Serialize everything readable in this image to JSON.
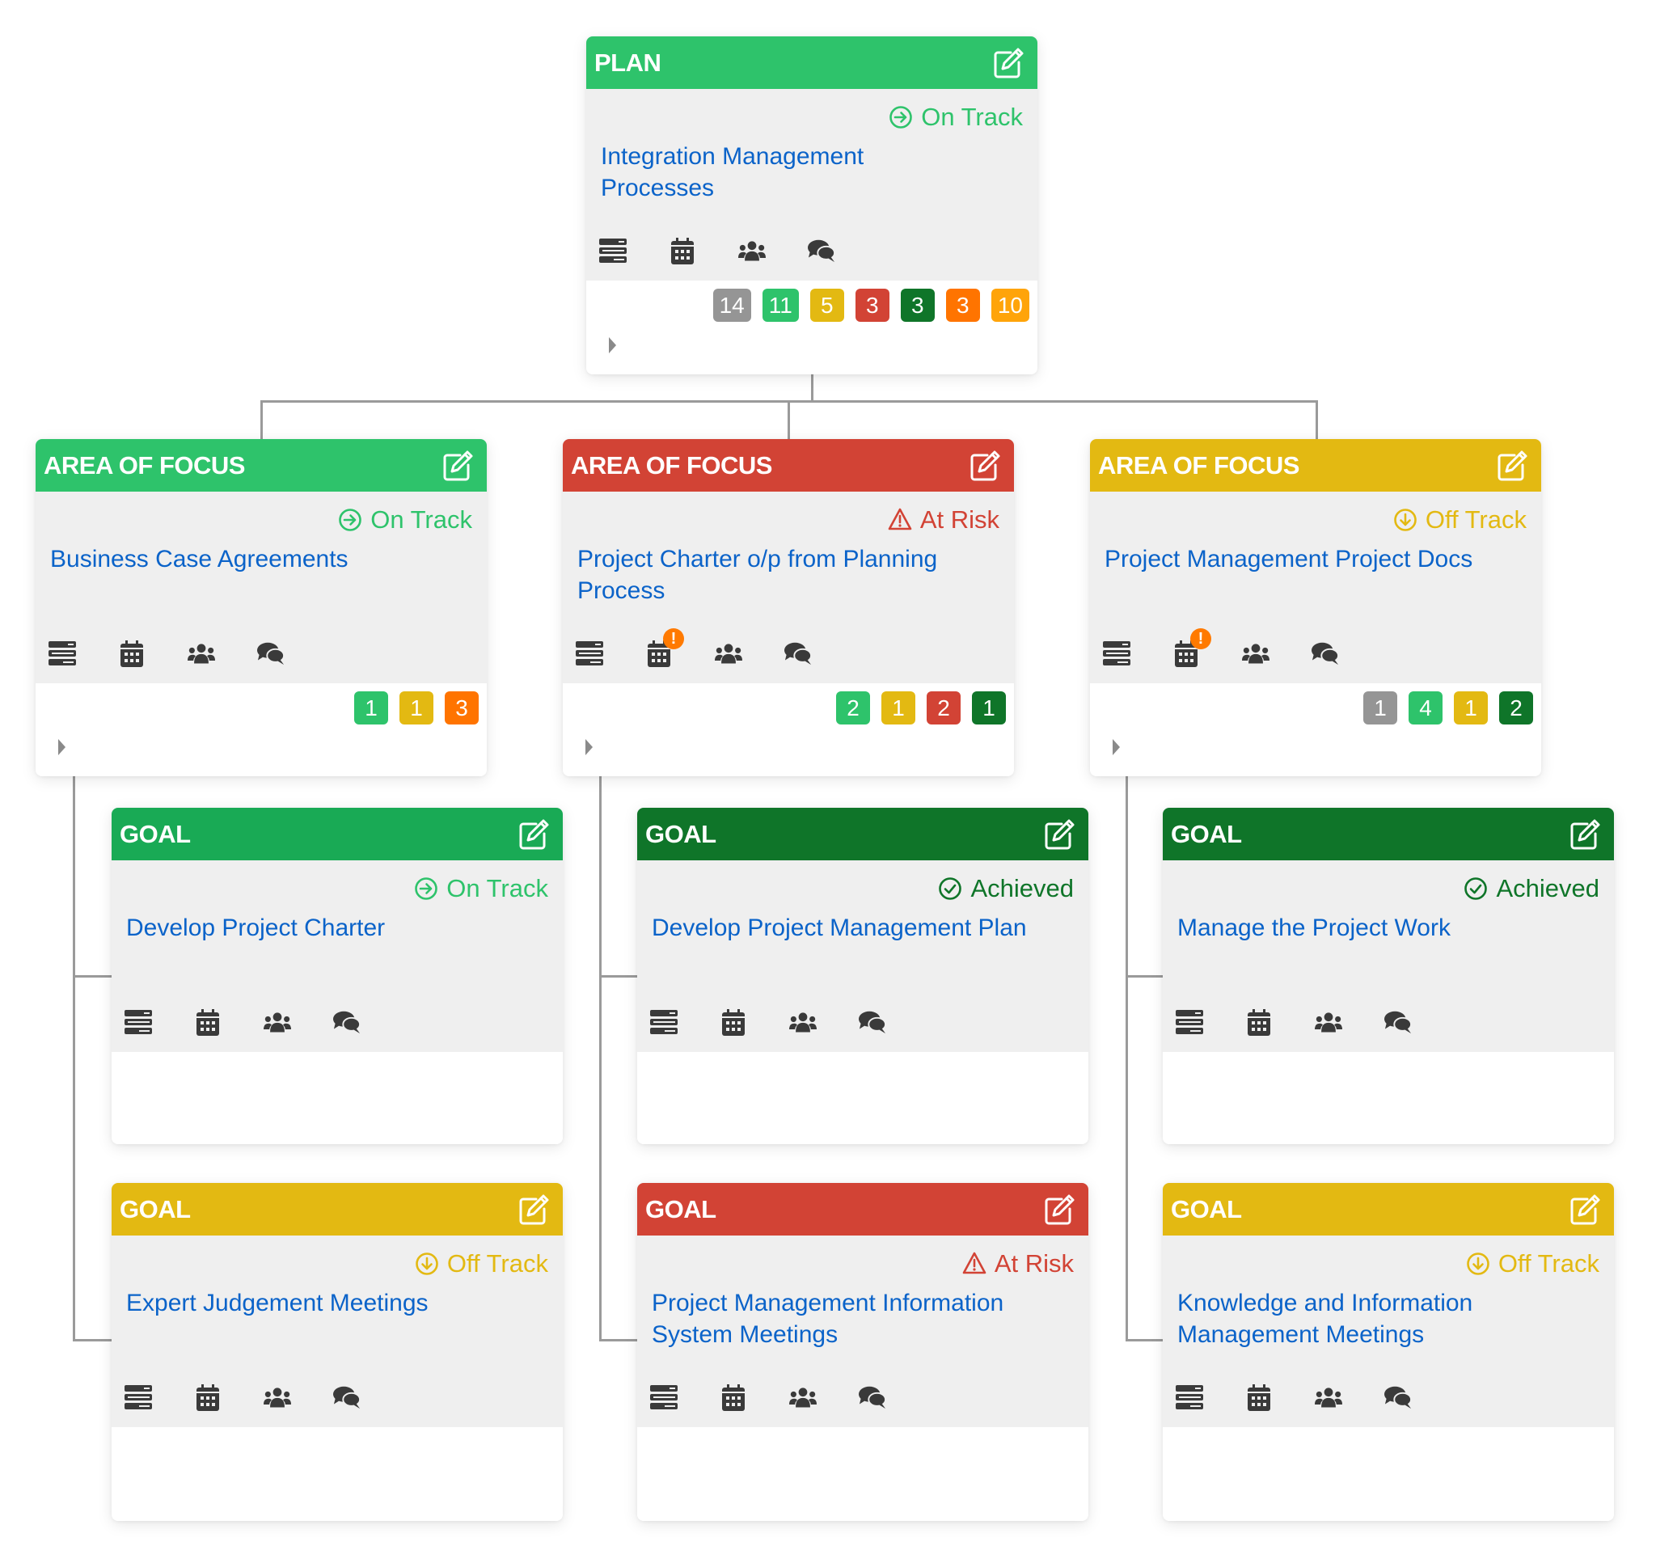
{
  "colors": {
    "on_track": "#2ec36b",
    "goal_on_track_header": "#19aa55",
    "at_risk": "#d24335",
    "off_track": "#e3b912",
    "achieved": "#0f7529",
    "not_started": "#959595",
    "orange": "#ff7400",
    "amber": "#ffa40a",
    "link": "#0b63c9",
    "icon": "#3a3a3a"
  },
  "plan": {
    "type_label": "PLAN",
    "status": {
      "label": "On Track",
      "icon": "arrow-circle-right-icon"
    },
    "name_line1": "Integration Management",
    "name_line2": "Processes",
    "badges": [
      {
        "value": "14",
        "status": "not-started"
      },
      {
        "value": "11",
        "status": "on-track"
      },
      {
        "value": "5",
        "status": "off-track"
      },
      {
        "value": "3",
        "status": "at-risk"
      },
      {
        "value": "3",
        "status": "achieved"
      },
      {
        "value": "3",
        "status": "orange"
      },
      {
        "value": "10",
        "status": "amber"
      }
    ]
  },
  "areas_of_focus": [
    {
      "type_label": "AREA OF FOCUS",
      "status": {
        "label": "On Track",
        "icon": "arrow-circle-right-icon"
      },
      "name_line1": "Business Case Agreements",
      "name_line2": "",
      "calendar_alert": false,
      "badges": [
        {
          "value": "1",
          "status": "on-track"
        },
        {
          "value": "1",
          "status": "off-track"
        },
        {
          "value": "3",
          "status": "orange"
        }
      ]
    },
    {
      "type_label": "AREA OF FOCUS",
      "status": {
        "label": "At Risk",
        "icon": "warning-triangle-icon"
      },
      "name_line1": "Project Charter o/p from Planning",
      "name_line2": "Process",
      "calendar_alert": true,
      "calendar_alert_symbol": "!",
      "badges": [
        {
          "value": "2",
          "status": "on-track"
        },
        {
          "value": "1",
          "status": "off-track"
        },
        {
          "value": "2",
          "status": "at-risk"
        },
        {
          "value": "1",
          "status": "achieved"
        }
      ]
    },
    {
      "type_label": "AREA OF FOCUS",
      "status": {
        "label": "Off Track",
        "icon": "arrow-circle-down-icon"
      },
      "name_line1": "Project Management Project Docs",
      "name_line2": "",
      "calendar_alert": true,
      "calendar_alert_symbol": "!",
      "badges": [
        {
          "value": "1",
          "status": "not-started"
        },
        {
          "value": "4",
          "status": "on-track"
        },
        {
          "value": "1",
          "status": "off-track"
        },
        {
          "value": "2",
          "status": "achieved"
        }
      ]
    }
  ],
  "goals": [
    {
      "type_label": "GOAL",
      "status": {
        "label": "On Track",
        "icon": "arrow-circle-right-icon"
      },
      "name_line1": "Develop Project Charter",
      "name_line2": ""
    },
    {
      "type_label": "GOAL",
      "status": {
        "label": "Achieved",
        "icon": "check-circle-icon"
      },
      "name_line1": "Develop Project Management Plan",
      "name_line2": ""
    },
    {
      "type_label": "GOAL",
      "status": {
        "label": "Achieved",
        "icon": "check-circle-icon"
      },
      "name_line1": "Manage the Project Work",
      "name_line2": ""
    },
    {
      "type_label": "GOAL",
      "status": {
        "label": "Off Track",
        "icon": "arrow-circle-down-icon"
      },
      "name_line1": "Expert Judgement Meetings",
      "name_line2": ""
    },
    {
      "type_label": "GOAL",
      "status": {
        "label": "At Risk",
        "icon": "warning-triangle-icon"
      },
      "name_line1": "Project Management Information",
      "name_line2": "System Meetings"
    },
    {
      "type_label": "GOAL",
      "status": {
        "label": "Off Track",
        "icon": "arrow-circle-down-icon"
      },
      "name_line1": "Knowledge and Information",
      "name_line2": "Management Meetings"
    }
  ]
}
